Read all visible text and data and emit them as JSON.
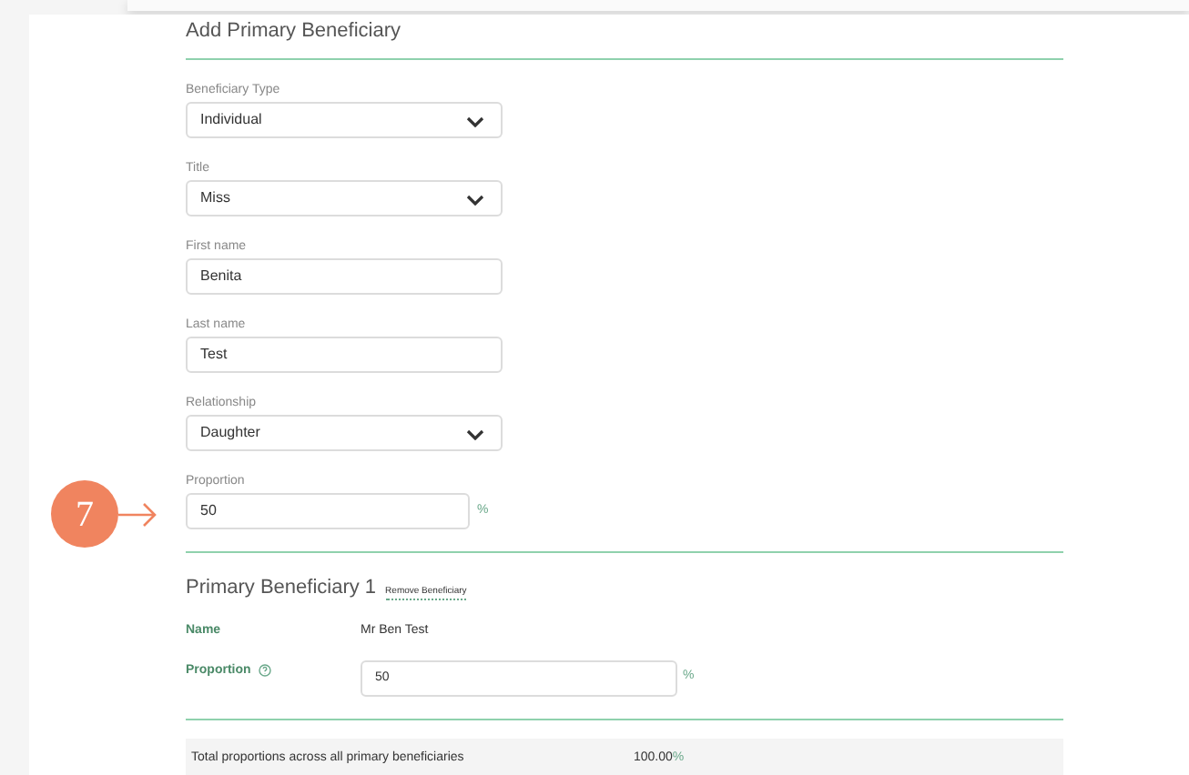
{
  "heading": "Add Primary Beneficiary",
  "fields": [
    {
      "kind": "select",
      "label": "Beneficiary Type",
      "value": "Individual"
    },
    {
      "kind": "select",
      "label": "Title",
      "value": "Miss"
    },
    {
      "kind": "text",
      "label": "First name",
      "value": "Benita"
    },
    {
      "kind": "text",
      "label": "Last name",
      "value": "Test"
    },
    {
      "kind": "select",
      "label": "Relationship",
      "value": "Daughter"
    },
    {
      "kind": "percent",
      "label": "Proportion",
      "value": "50",
      "unit": "%"
    }
  ],
  "callout": {
    "number": "7"
  },
  "beneficiary": {
    "title": "Primary Beneficiary 1",
    "remove_link": "Remove Beneficiary",
    "name_label": "Name",
    "name_value": "Mr Ben Test",
    "proportion_label": "Proportion",
    "proportion_value": "50",
    "unit": "%"
  },
  "total": {
    "label": "Total proportions across all primary beneficiaries",
    "value": "100.00",
    "unit": "%"
  }
}
